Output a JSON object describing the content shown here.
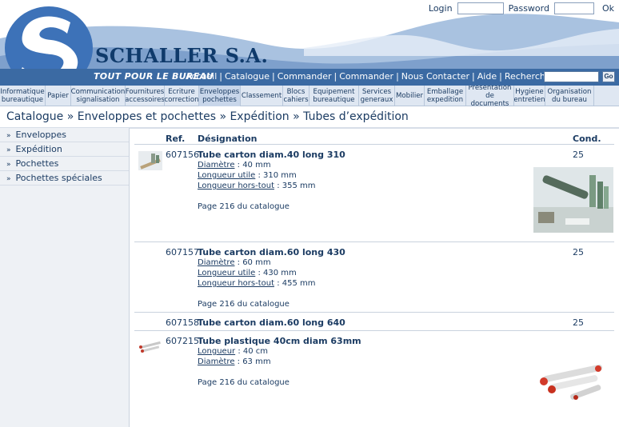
{
  "header": {
    "company": "SCHALLER S.A.",
    "slogan": "TOUT POUR LE BUREAU",
    "login_label": "Login",
    "password_label": "Password",
    "ok_label": "Ok",
    "login_value": "",
    "password_value": ""
  },
  "topnav": {
    "items": [
      "Accueil",
      "Catalogue",
      "Commander",
      "Commander",
      "Nous Contacter",
      "Aide"
    ],
    "quick_search_label": "Recherche rapide :",
    "quick_search_value": "",
    "go_label": "Go"
  },
  "categories": [
    "Informatique\nbureautique",
    "Papier",
    "Communication\nsignalisation",
    "Fournitures\naccessoires",
    "Ecriture\ncorrection",
    "Enveloppes\npochettes",
    "Classement",
    "Blocs\ncahiers",
    "Equipement\nbureautique",
    "Services\ngeneraux",
    "Mobilier",
    "Emballage\nexpedition",
    "Presentation\nde documents",
    "Hygiene\nentretien",
    "Organisation\ndu bureau"
  ],
  "breadcrumb": "Catalogue » Enveloppes et pochettes » Expédition » Tubes d’expédition",
  "sidebar": {
    "items": [
      "Enveloppes",
      "Expédition",
      "Pochettes",
      "Pochettes spéciales"
    ]
  },
  "table": {
    "headers": {
      "ref": "Ref.",
      "designation": "Désignation",
      "cond": "Cond."
    },
    "rows": [
      {
        "ref": "607156",
        "designation": "Tube carton diam.40 long 310",
        "cond": "25",
        "attrs": [
          {
            "k": "Diamètre",
            "v": " : 40 mm"
          },
          {
            "k": "Longueur utile",
            "v": " : 310 mm"
          },
          {
            "k": "Longueur hors-tout",
            "v": " : 355 mm"
          }
        ],
        "page": "Page 216 du catalogue"
      },
      {
        "ref": "607157",
        "designation": "Tube carton diam.60 long 430",
        "cond": "25",
        "attrs": [
          {
            "k": "Diamètre",
            "v": " : 60 mm"
          },
          {
            "k": "Longueur utile",
            "v": " : 430 mm"
          },
          {
            "k": "Longueur hors-tout",
            "v": " : 455 mm"
          }
        ],
        "page": "Page 216 du catalogue"
      },
      {
        "ref": "607158",
        "designation": "Tube carton diam.60 long 640",
        "cond": "25",
        "attrs": [],
        "page": ""
      },
      {
        "ref": "607215",
        "designation": "Tube plastique 40cm diam 63mm",
        "cond": "",
        "attrs": [
          {
            "k": "Longueur",
            "v": " : 40 cm"
          },
          {
            "k": "Diamètre",
            "v": " : 63 mm"
          }
        ],
        "page": "Page 216 du catalogue"
      }
    ]
  },
  "colors": {
    "brand_blue": "#0f3a6b",
    "bar_blue": "#3b6aa3",
    "light_blue": "#dfe7f2"
  }
}
